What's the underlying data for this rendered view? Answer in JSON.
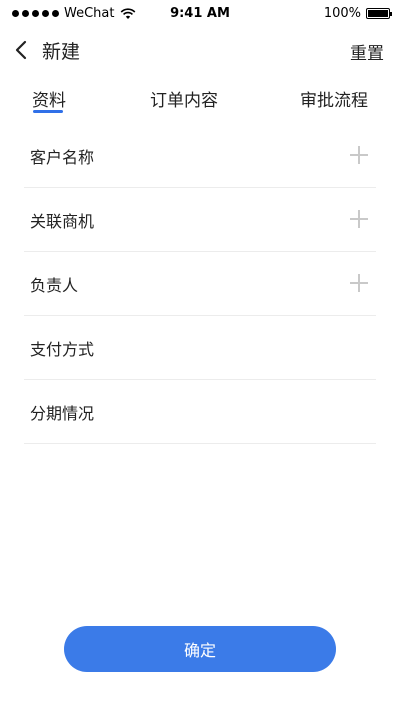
{
  "status_bar": {
    "carrier": "WeChat",
    "time": "9:41 AM",
    "battery": "100%",
    "battery_level": 1.0
  },
  "nav": {
    "title": "新建",
    "reset_label": "重置",
    "back_icon": "chevron-left-icon"
  },
  "tabs": [
    {
      "label": "资料",
      "active": true
    },
    {
      "label": "订单内容",
      "active": false
    },
    {
      "label": "审批流程",
      "active": false
    }
  ],
  "colors": {
    "accent": "#3b7be8",
    "divider": "#ececec",
    "plus_icon": "#c9c9c9"
  },
  "form": {
    "rows": [
      {
        "label": "客户名称",
        "has_add": true
      },
      {
        "label": "关联商机",
        "has_add": true
      },
      {
        "label": "负责人",
        "has_add": true
      },
      {
        "label": "支付方式",
        "has_add": false
      },
      {
        "label": "分期情况",
        "has_add": false
      }
    ]
  },
  "footer": {
    "confirm_label": "确定"
  }
}
